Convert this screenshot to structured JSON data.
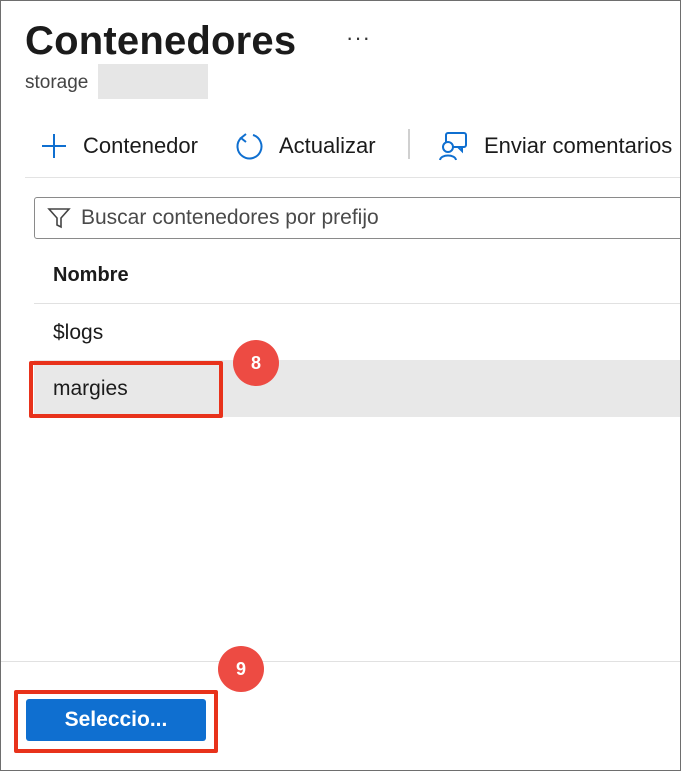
{
  "page": {
    "title": "Contenedores",
    "more_glyph": "···",
    "subtitle": "storage"
  },
  "toolbar": {
    "add_label": "Contenedor",
    "refresh_label": "Actualizar",
    "feedback_label": "Enviar comentarios"
  },
  "search": {
    "placeholder": "Buscar contenedores por prefijo"
  },
  "table": {
    "column_header": "Nombre",
    "rows": [
      "$logs",
      "margies"
    ]
  },
  "annotations": {
    "step_8": "8",
    "step_9": "9"
  },
  "footer": {
    "select_label": "Seleccio..."
  },
  "colors": {
    "accent": "#0f6fd0",
    "highlight": "#e8321b",
    "badge": "#ed4b43",
    "selected_row": "#e8e8e8"
  }
}
